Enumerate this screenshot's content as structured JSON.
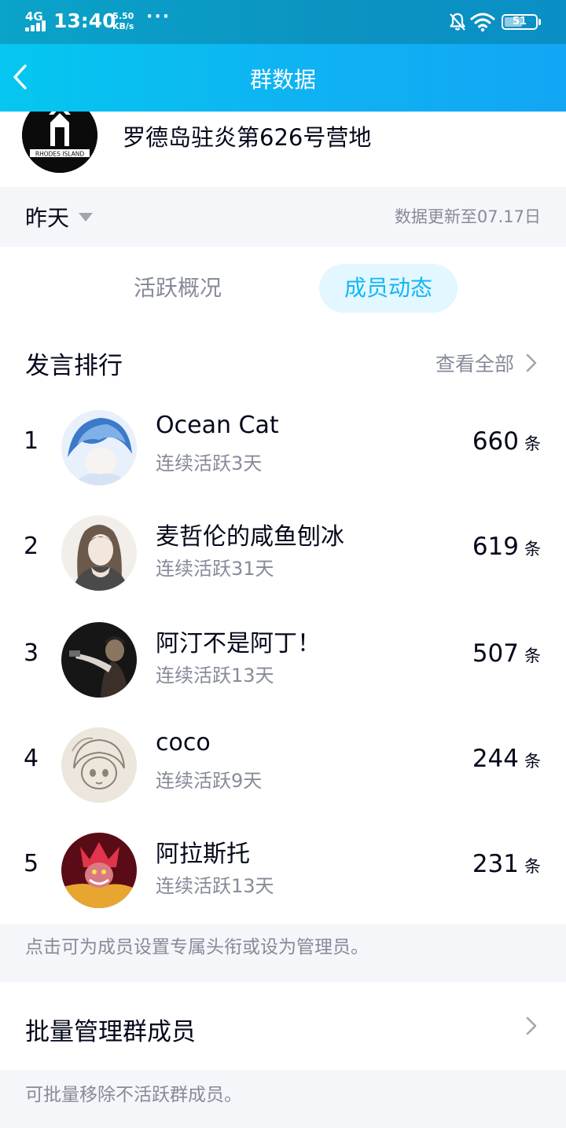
{
  "status_bar": {
    "network": "4G",
    "time": "13:40",
    "speed_value": "5.50",
    "speed_unit": "KB/s",
    "dots": "···",
    "battery": "51"
  },
  "title_bar": {
    "title": "群数据"
  },
  "group": {
    "name": "罗德岛驻炎第626号营地",
    "avatar_caption": "RHODES ISLAND"
  },
  "date_filter": {
    "selected": "昨天",
    "update_note": "数据更新至07.17日"
  },
  "tabs": [
    {
      "label": "活跃概况",
      "active": false
    },
    {
      "label": "成员动态",
      "active": true
    }
  ],
  "ranking": {
    "header": "发言排行",
    "view_all": "查看全部",
    "unit": "条",
    "members": [
      {
        "rank": "1",
        "name": "Ocean Cat",
        "streak": "连续活跃3天",
        "count": "660",
        "avatar_colors": [
          "#e8f0fb",
          "#3c79c9"
        ]
      },
      {
        "rank": "2",
        "name": "麦哲伦的咸鱼刨冰",
        "streak": "连续活跃31天",
        "count": "619",
        "avatar_colors": [
          "#f2efea",
          "#6b5a4c"
        ]
      },
      {
        "rank": "3",
        "name": "阿汀不是阿丁！",
        "streak": "连续活跃13天",
        "count": "507",
        "avatar_colors": [
          "#161616",
          "#8a7560"
        ]
      },
      {
        "rank": "4",
        "name": "coco",
        "streak": "连续活跃9天",
        "count": "244",
        "avatar_colors": [
          "#ece6dc",
          "#8c8278"
        ]
      },
      {
        "rank": "5",
        "name": "阿拉斯托",
        "streak": "连续活跃13天",
        "count": "231",
        "avatar_colors": [
          "#5a0c16",
          "#e0354b"
        ]
      }
    ]
  },
  "hints": {
    "members_tip": "点击可为成员设置专属头衔或设为管理员。",
    "batch_label": "批量管理群成员",
    "batch_tip": "可批量移除不活跃群成员。"
  },
  "colors": {
    "accent": "#12b7f5",
    "tab_active_bg": "#e2f7ff",
    "secondary_text": "#878b99",
    "primary_text": "#03081a"
  }
}
